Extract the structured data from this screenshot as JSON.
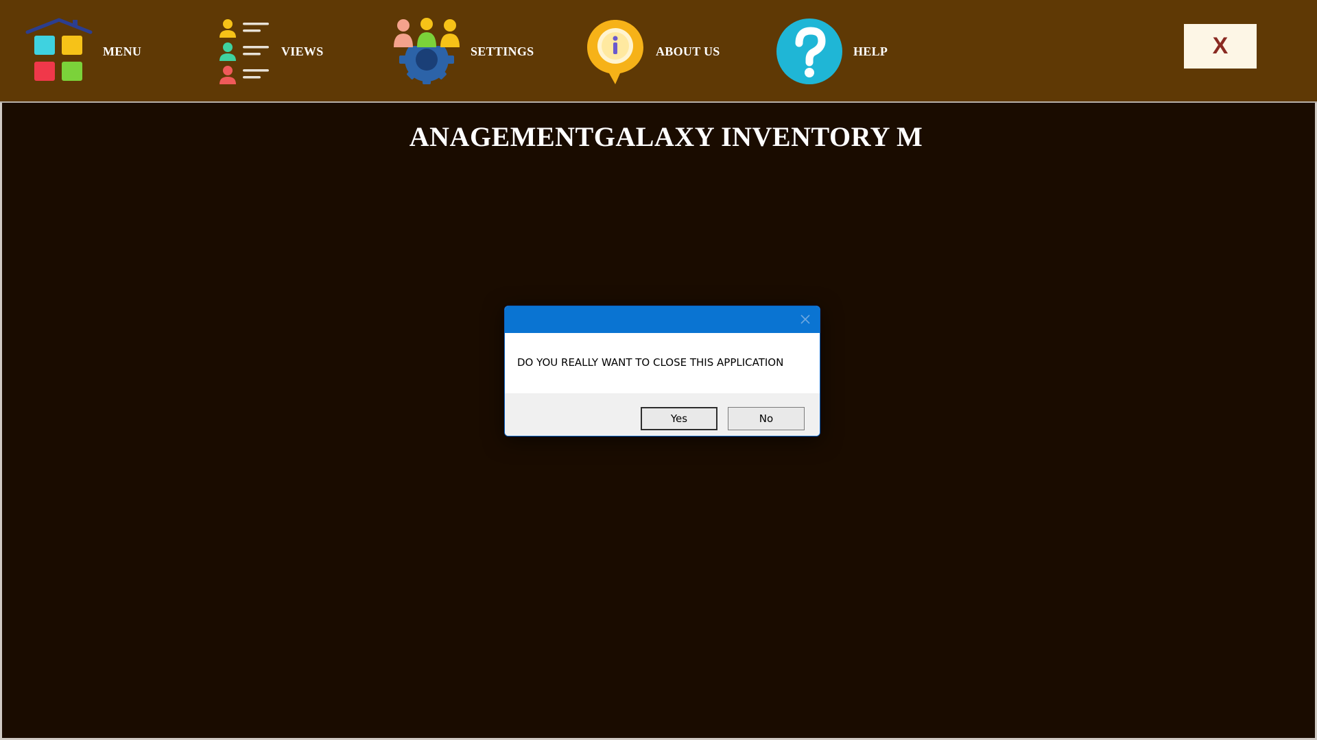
{
  "nav": {
    "items": [
      {
        "label": "MENU",
        "icon": "home-grid-icon"
      },
      {
        "label": "VIEWS",
        "icon": "user-list-icon"
      },
      {
        "label": "SETTINGS",
        "icon": "team-gear-icon"
      },
      {
        "label": "ABOUT US",
        "icon": "info-icon"
      },
      {
        "label": "HELP",
        "icon": "question-icon"
      }
    ],
    "close_label": "X"
  },
  "main": {
    "title": "ANAGEMENTGALAXY INVENTORY M"
  },
  "dialog": {
    "message": "DO YOU REALLY WANT TO CLOSE THIS APPLICATION",
    "yes_label": "Yes",
    "no_label": "No"
  },
  "colors": {
    "topbar_bg": "#5f3905",
    "main_bg": "#1a0c00",
    "dialog_titlebar": "#0a74d2",
    "close_button_bg": "#fdf6e6",
    "close_button_text": "#8a2a22"
  }
}
